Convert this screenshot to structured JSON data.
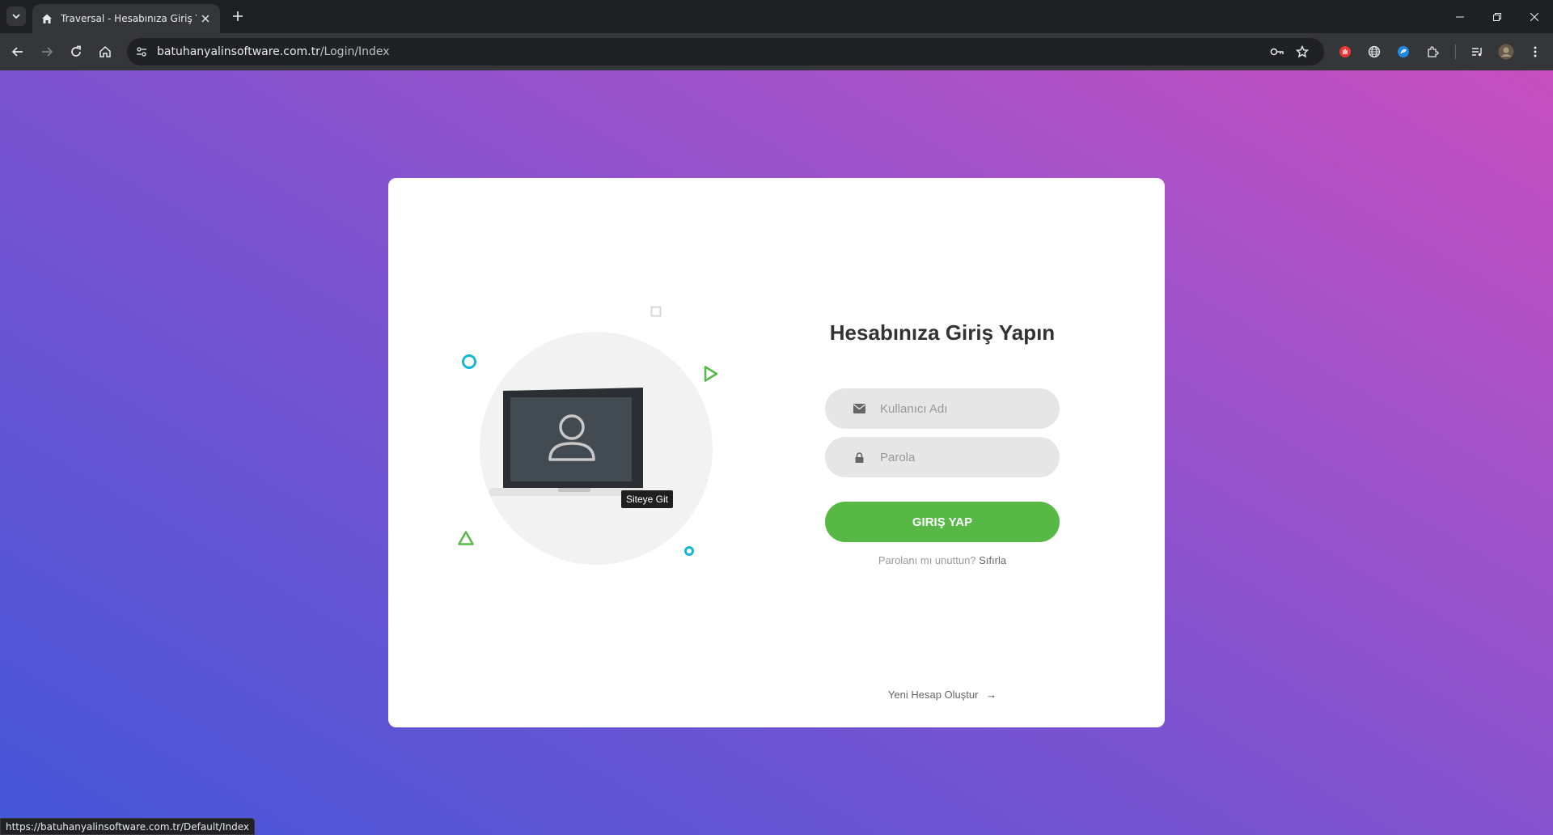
{
  "browser": {
    "tab": {
      "title": "Traversal - Hesabınıza Giriş Yapın",
      "favicon": "home-icon"
    },
    "url": {
      "host": "batuhanyalinsoftware.com.tr",
      "path": "/Login/Index"
    },
    "status_bar_url": "https://batuhanyalinsoftware.com.tr/Default/Index"
  },
  "page": {
    "illustration": {
      "tooltip": "Siteye Git",
      "icon": "laptop-user-icon"
    },
    "login": {
      "title": "Hesabınıza Giriş Yapın",
      "username_placeholder": "Kullanıcı Adı",
      "password_placeholder": "Parola",
      "submit_label": "GIRIŞ YAP",
      "forgot_text": "Parolanı mı unuttun?",
      "forgot_link": "Sıfırla",
      "signup_label": "Yeni Hesap Oluştur",
      "signup_arrow": "→"
    }
  },
  "colors": {
    "accent_green": "#57b846",
    "gradient_start": "#4456d8",
    "gradient_end": "#c84fc0",
    "shape_cyan": "#15b7d6",
    "shape_green": "#57b846"
  }
}
